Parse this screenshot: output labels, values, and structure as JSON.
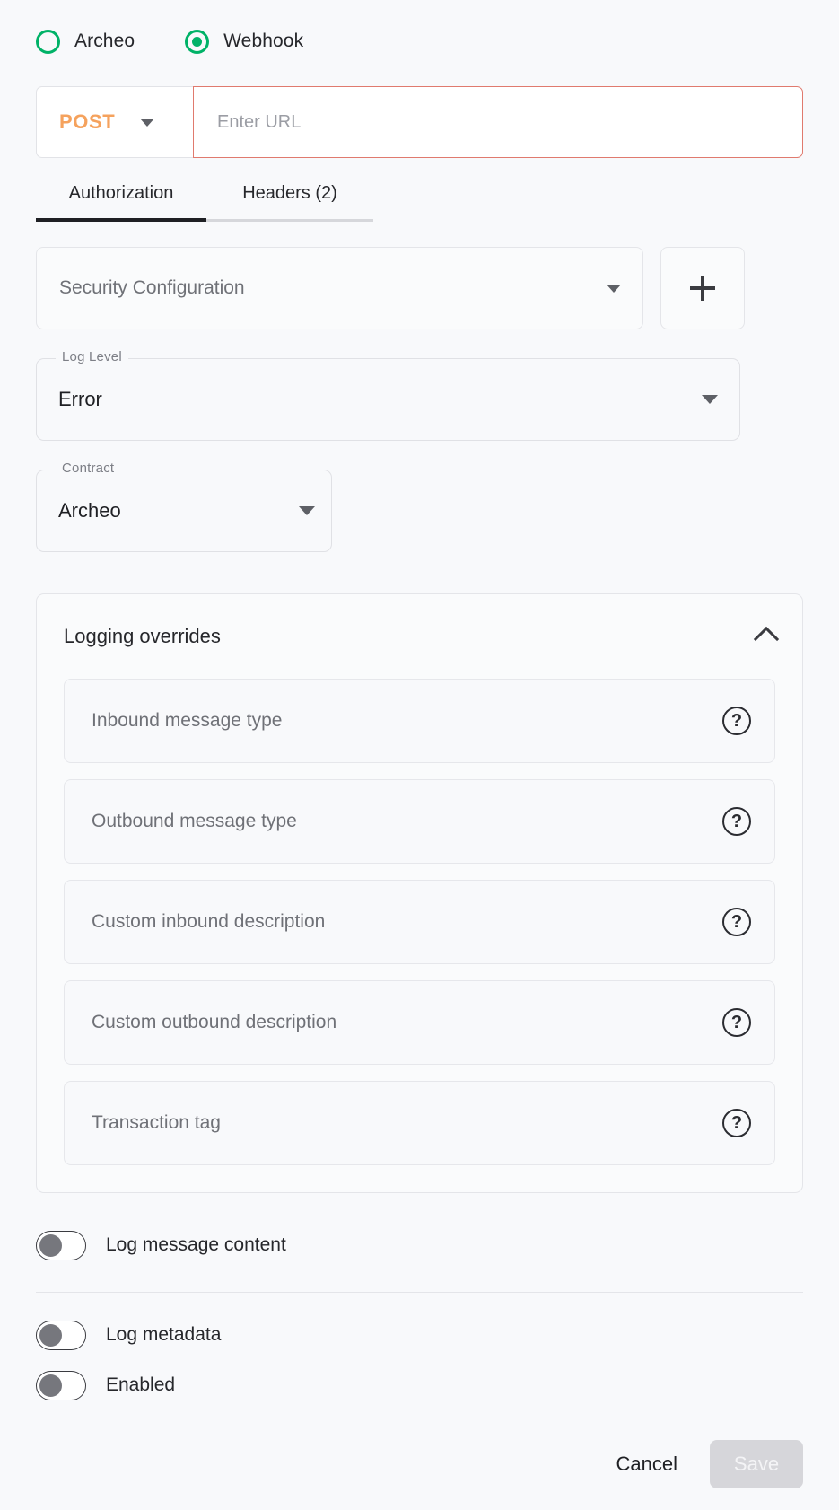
{
  "destination": {
    "options": [
      {
        "label": "Archeo",
        "selected": false
      },
      {
        "label": "Webhook",
        "selected": true
      }
    ],
    "accent_color": "#00b267"
  },
  "request": {
    "method": "POST",
    "method_color": "#f5a25d",
    "url_value": "",
    "url_placeholder": "Enter URL",
    "url_error_border_color": "#e07a6e"
  },
  "tabs": [
    {
      "label": "Authorization",
      "active": true
    },
    {
      "label": "Headers (2)",
      "active": false
    }
  ],
  "security": {
    "select_placeholder": "Security Configuration",
    "add_icon": "plus-icon"
  },
  "log_level": {
    "legend": "Log Level",
    "value": "Error"
  },
  "contract": {
    "legend": "Contract",
    "value": "Archeo"
  },
  "logging_overrides": {
    "title": "Logging overrides",
    "expanded": true,
    "collapse_icon": "chevron-up-icon",
    "fields": [
      {
        "placeholder": "Inbound message type",
        "help_icon": "help-circle-icon"
      },
      {
        "placeholder": "Outbound message type",
        "help_icon": "help-circle-icon"
      },
      {
        "placeholder": "Custom inbound description",
        "help_icon": "help-circle-icon"
      },
      {
        "placeholder": "Custom outbound description",
        "help_icon": "help-circle-icon"
      },
      {
        "placeholder": "Transaction tag",
        "help_icon": "help-circle-icon"
      }
    ]
  },
  "toggles": [
    {
      "label": "Log message content",
      "on": false
    },
    {
      "label": "Log metadata",
      "on": false
    },
    {
      "label": "Enabled",
      "on": false
    }
  ],
  "footer": {
    "cancel_label": "Cancel",
    "save_label": "Save",
    "save_disabled": true,
    "save_disabled_bg": "#d6d6da"
  },
  "help_glyph": "?"
}
